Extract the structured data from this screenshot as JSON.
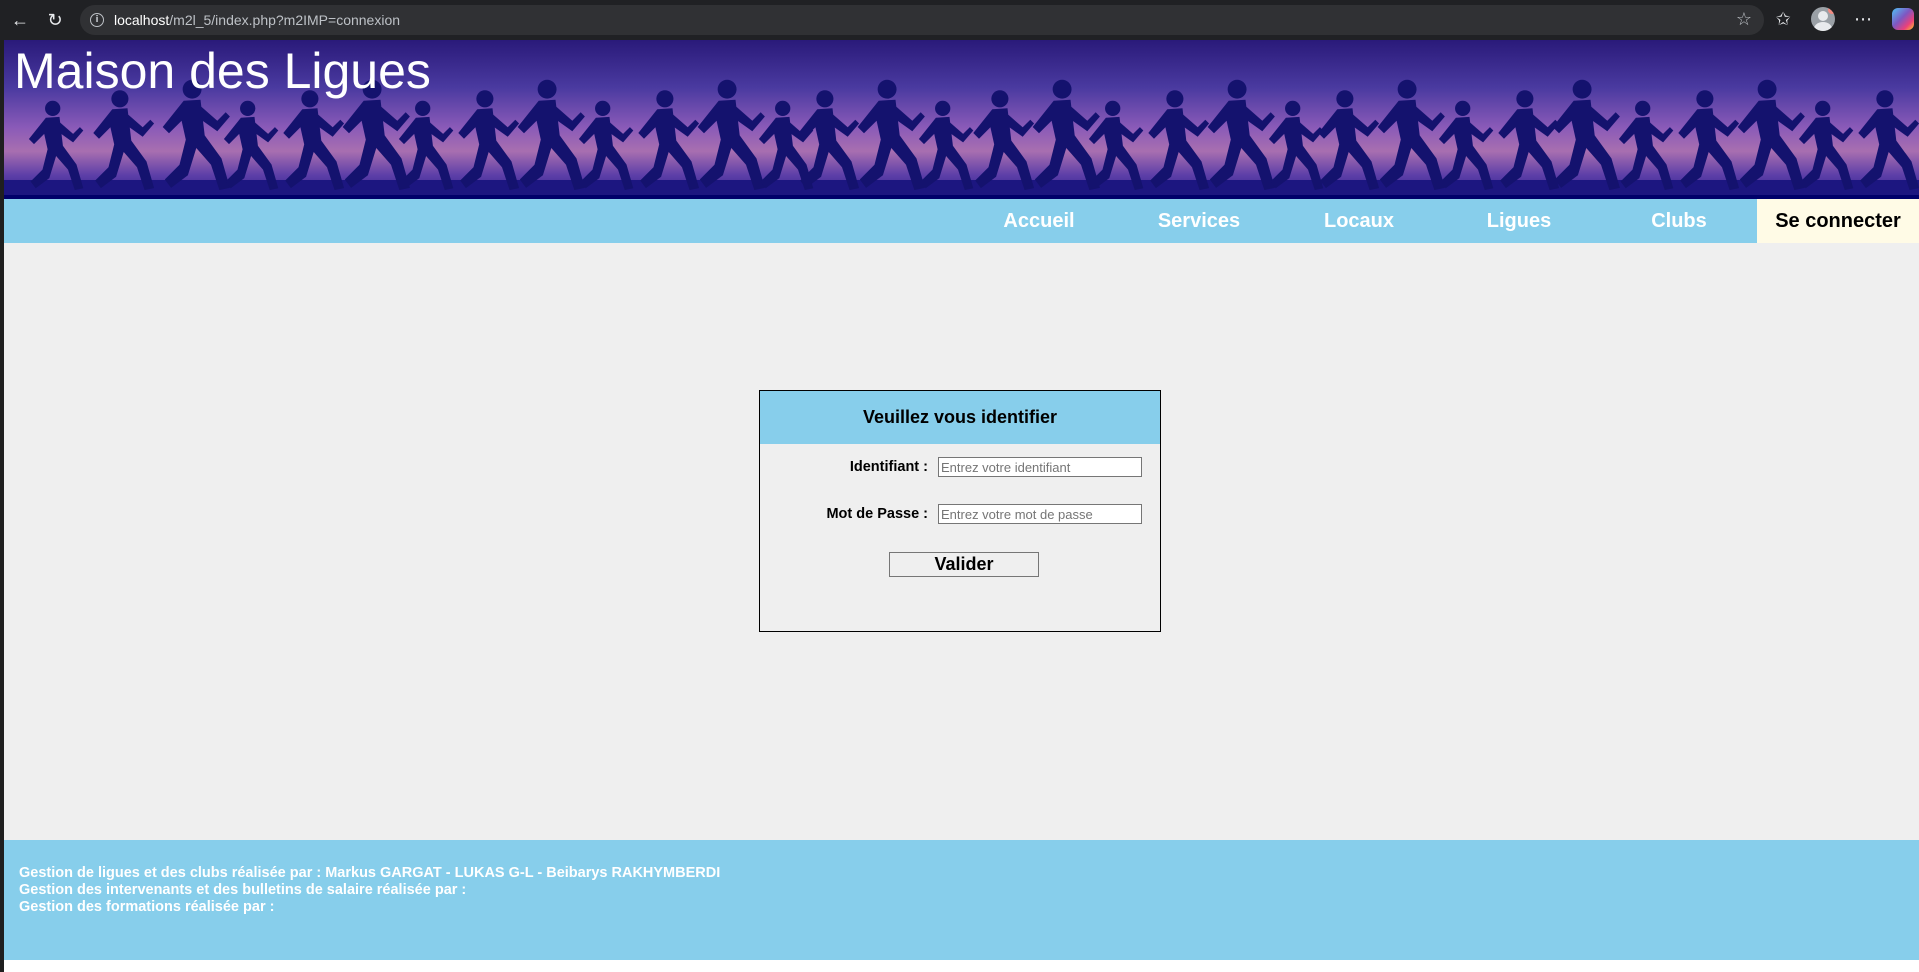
{
  "browser": {
    "url_host": "localhost",
    "url_path": "/m2l_5/index.php?m2IMP=connexion",
    "icons": [
      "back-arrow-icon",
      "reload-icon",
      "site-info-icon",
      "star-icon",
      "favorites-icon",
      "profile-avatar",
      "more-menu-icon",
      "copilot-icon"
    ]
  },
  "header": {
    "title": "Maison des Ligues"
  },
  "menu": {
    "items": [
      {
        "label": "Accueil"
      },
      {
        "label": "Services"
      },
      {
        "label": "Locaux"
      },
      {
        "label": "Ligues"
      },
      {
        "label": "Clubs"
      },
      {
        "label": "Se connecter"
      }
    ],
    "active": "Se connecter"
  },
  "login": {
    "heading": "Veuillez vous identifier",
    "username_label": "Identifiant :",
    "username_placeholder": "Entrez votre identifiant",
    "username_value": "",
    "password_label": "Mot de Passe :",
    "password_placeholder": "Entrez votre mot de passe",
    "password_value": "",
    "submit_label": "Valider"
  },
  "footer": {
    "lines": [
      "Gestion de ligues et des clubs réalisée par : Markus GARGAT - LUKAS G-L - Beibarys RAKHYMBERDI",
      "Gestion des intervenants et des bulletins de salaire réalisée par :",
      "Gestion des formations réalisée par :"
    ]
  },
  "colors": {
    "menu_bg": "#87ceeb",
    "active_menu_bg": "#fffbe6",
    "page_bg": "#efefef",
    "banner_dark": "#00006a"
  }
}
